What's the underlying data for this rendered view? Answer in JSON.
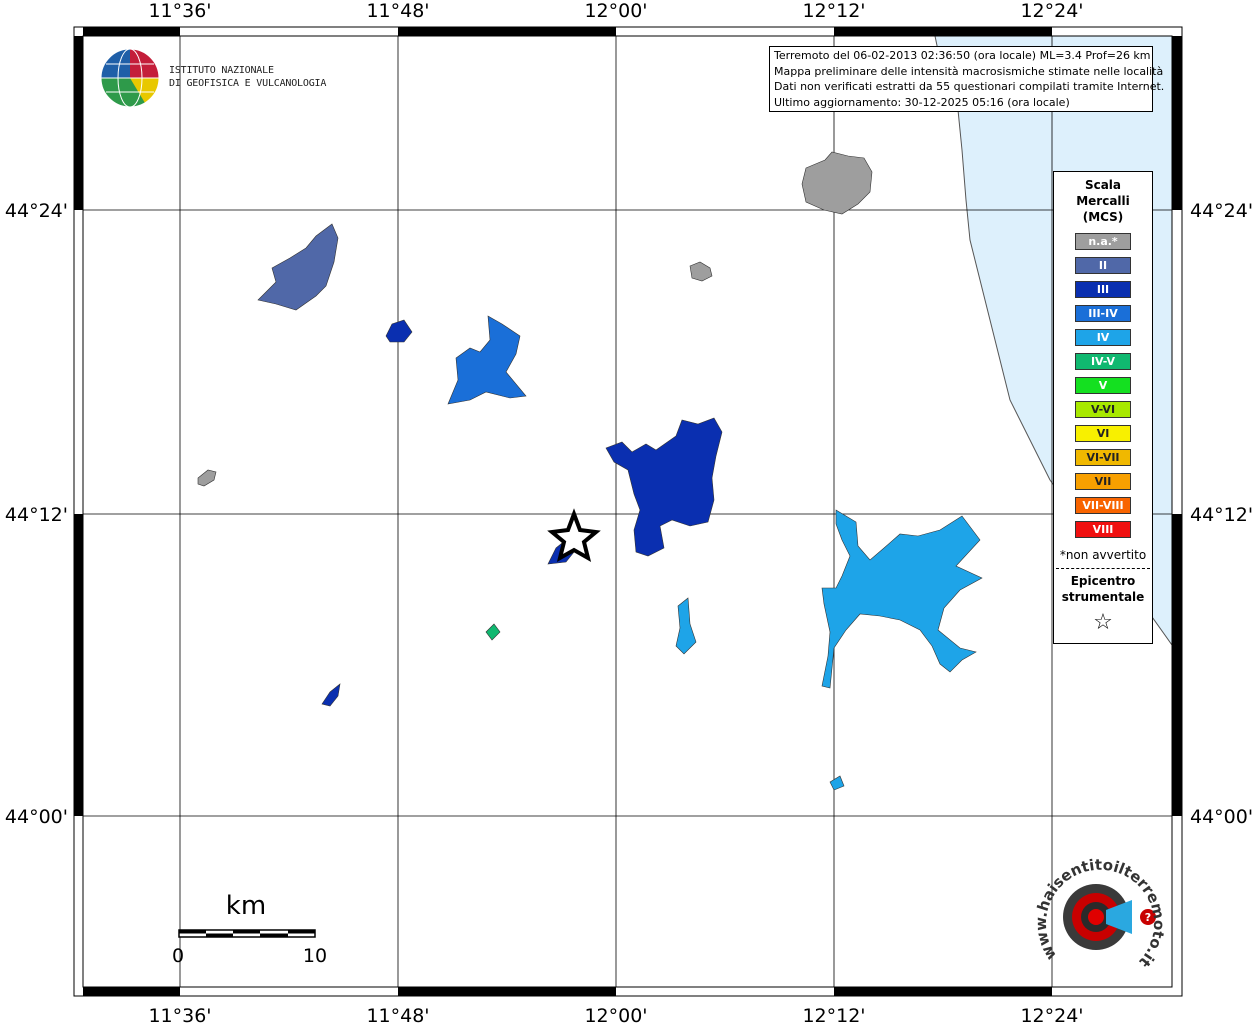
{
  "info": {
    "line1": "Terremoto del 06-02-2013 02:36:50 (ora locale) ML=3.4 Prof=26 km",
    "line2": "Mappa preliminare delle intensità macrosismiche stimate nelle località",
    "line3": "Dati non verificati estratti da 55 questionari compilati tramite Internet.",
    "line4": "Ultimo aggiornamento: 30-12-2025 05:16 (ora locale)"
  },
  "logo": {
    "line1": "ISTITUTO NAZIONALE",
    "line2": "DI GEOFISICA E VULCANOLOGIA",
    "haisentito_text": "www.haisentitoilterremoto.it"
  },
  "axes": {
    "lon_labels": [
      "11°36'",
      "11°48'",
      "12°00'",
      "12°12'",
      "12°24'"
    ],
    "lat_labels": [
      "44°24'",
      "44°12'",
      "44°00'"
    ]
  },
  "scalebar": {
    "unit": "km",
    "start": "0",
    "end": "10"
  },
  "legend": {
    "title_line1": "Scala",
    "title_line2": "Mercalli",
    "title_line3": "(MCS)",
    "items": [
      {
        "label": "n.a.*",
        "color": "#9e9e9e"
      },
      {
        "label": "II",
        "color": "#5068a8"
      },
      {
        "label": "III",
        "color": "#0a2fb0"
      },
      {
        "label": "III-IV",
        "color": "#1a6fd8"
      },
      {
        "label": "IV",
        "color": "#1ea4e8"
      },
      {
        "label": "IV-V",
        "color": "#10b870"
      },
      {
        "label": "V",
        "color": "#14e020"
      },
      {
        "label": "V-VI",
        "color": "#a8e800"
      },
      {
        "label": "VI",
        "color": "#f8f000"
      },
      {
        "label": "VI-VII",
        "color": "#f0b800"
      },
      {
        "label": "VII",
        "color": "#f8a000"
      },
      {
        "label": "VII-VIII",
        "color": "#f86400"
      },
      {
        "label": "VIII",
        "color": "#f01010"
      }
    ],
    "note": "*non avvertito",
    "epicentre_line1": "Epicentro",
    "epicentre_line2": "strumentale",
    "star": "☆"
  },
  "colors": {
    "sea": "#ddf0fc",
    "na": "#9e9e9e",
    "II": "#5068a8",
    "III": "#0a2fb0",
    "III_IV": "#1a6fd8",
    "IV": "#1ea4e8",
    "IV_V": "#10b870"
  }
}
